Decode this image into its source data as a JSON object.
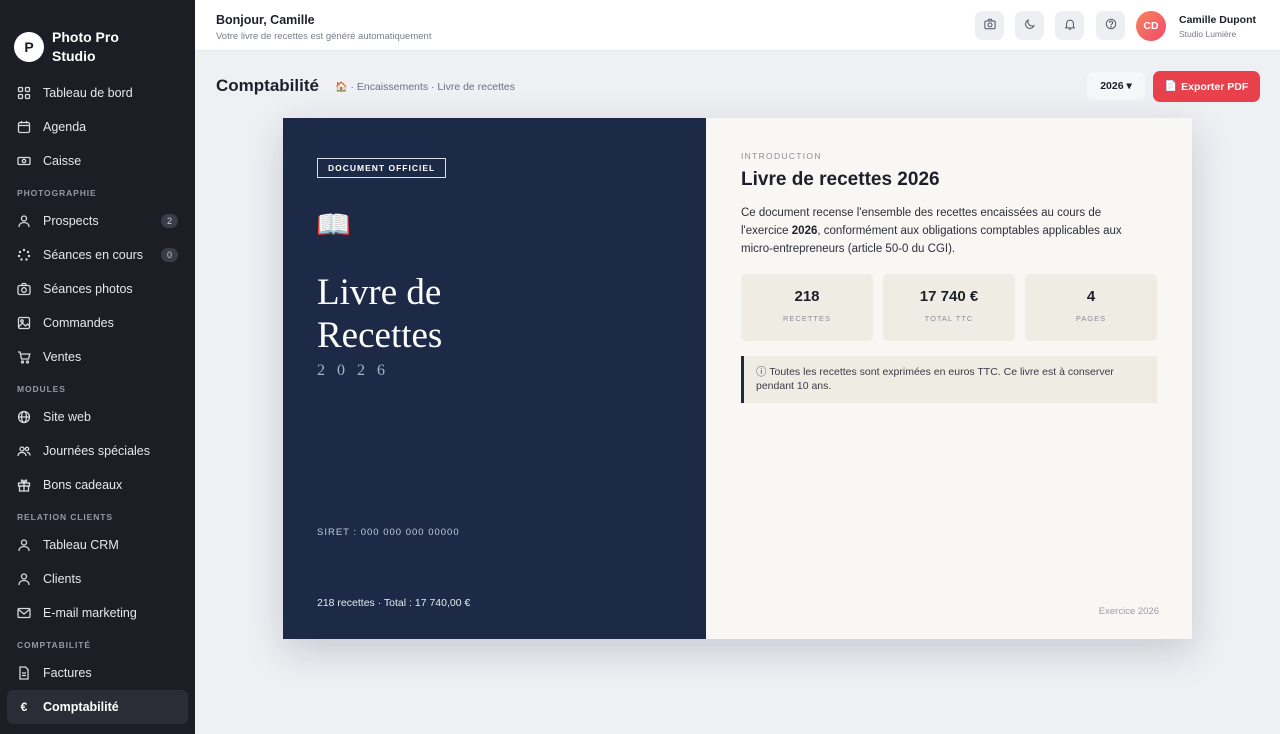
{
  "brand": {
    "logo_letter": "P",
    "name": "Photo Pro Studio"
  },
  "sidebar": {
    "top_items": [
      {
        "label": "Tableau de bord",
        "icon": "grid-icon"
      },
      {
        "label": "Agenda",
        "icon": "calendar-icon"
      },
      {
        "label": "Caisse",
        "icon": "cash-icon"
      }
    ],
    "sections": [
      {
        "title": "PHOTOGRAPHIE",
        "items": [
          {
            "label": "Prospects",
            "icon": "user-icon",
            "badge": "2"
          },
          {
            "label": "Séances en cours",
            "icon": "spinner-icon",
            "badge": "0"
          },
          {
            "label": "Séances photos",
            "icon": "camera-icon"
          },
          {
            "label": "Commandes",
            "icon": "image-icon"
          },
          {
            "label": "Ventes",
            "icon": "cart-icon"
          }
        ]
      },
      {
        "title": "MODULES",
        "items": [
          {
            "label": "Site web",
            "icon": "globe-icon"
          },
          {
            "label": "Journées spéciales",
            "icon": "users-icon"
          },
          {
            "label": "Bons cadeaux",
            "icon": "gift-icon"
          }
        ]
      },
      {
        "title": "RELATION CLIENTS",
        "items": [
          {
            "label": "Tableau CRM",
            "icon": "user-icon"
          },
          {
            "label": "Clients",
            "icon": "user-icon"
          },
          {
            "label": "E-mail marketing",
            "icon": "mail-icon"
          }
        ]
      },
      {
        "title": "COMPTABILITÉ",
        "items": [
          {
            "label": "Factures",
            "icon": "file-icon"
          },
          {
            "label": "Comptabilité",
            "icon": "euro-icon",
            "active": true
          }
        ]
      }
    ]
  },
  "topbar": {
    "greeting": "Bonjour, Camille",
    "subtitle": "Votre livre de recettes est généré automatiquement",
    "buttons": [
      "camera-icon",
      "moon-icon",
      "bell-icon",
      "help-icon"
    ],
    "user": {
      "initials": "CD",
      "name": "Camille Dupont",
      "studio": "Studio Lumière"
    }
  },
  "page": {
    "title": "Comptabilité",
    "breadcrumb": "· Encaissements · Livre de recettes",
    "year_select": "2026 ▾",
    "export_label": "Exporter PDF"
  },
  "cover": {
    "tag": "DOCUMENT OFFICIEL",
    "book_emoji": "📖",
    "title_line1": "Livre de",
    "title_line2": "Recettes",
    "year": "2026",
    "siret": "SIRET : 000 000 000 00000",
    "summary": "218 recettes · Total : 17 740,00 €"
  },
  "intro": {
    "kicker": "INTRODUCTION",
    "title": "Livre de recettes 2026",
    "text_before": "Ce document recense l'ensemble des recettes encaissées au cours de l'exercice ",
    "text_bold": "2026",
    "text_after": ", conformément aux obligations comptables applicables aux micro-entrepreneurs (article 50-0 du CGI).",
    "stats": [
      {
        "value": "218",
        "label": "RECETTES"
      },
      {
        "value": "17 740 €",
        "label": "TOTAL TTC"
      },
      {
        "value": "4",
        "label": "PAGES"
      }
    ],
    "notice": "ⓘ Toutes les recettes sont exprimées en euros TTC. Ce livre est à conserver pendant 10 ans.",
    "footer": "Exercice 2026"
  },
  "colors": {
    "sidebar_bg": "#1c1d25",
    "cover_bg": "#1c2a47",
    "accent": "#e8414b"
  }
}
